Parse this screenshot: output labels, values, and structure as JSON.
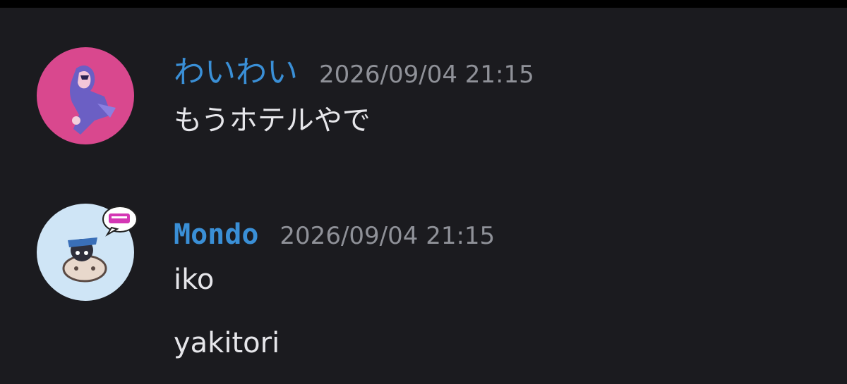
{
  "messages": [
    {
      "username": "わいわい",
      "timestamp": "2026/09/04 21:15",
      "avatar_icon": "user-avatar-pink",
      "name_color": "#3a8fd6",
      "lines": [
        "もうホテルやで"
      ]
    },
    {
      "username": "Mondo",
      "timestamp": "2026/09/04 21:15",
      "avatar_icon": "user-avatar-light-blue",
      "name_color": "#3a8fd6",
      "lines": [
        "iko",
        "yakitori"
      ]
    }
  ]
}
